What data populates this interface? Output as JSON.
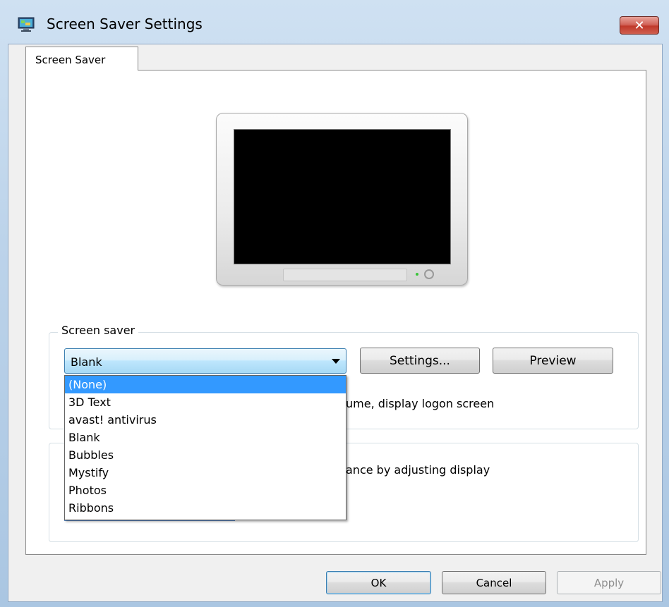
{
  "window": {
    "title": "Screen Saver Settings",
    "close_glyph": "✕",
    "icon": "display-settings-icon"
  },
  "tabs": [
    {
      "label": "Screen Saver",
      "active": true
    }
  ],
  "screensaver_group": {
    "legend": "Screen saver",
    "combo_selected": "Blank",
    "settings_label": "Settings...",
    "preview_label": "Preview",
    "resume_text_visible": "ume, display logon screen",
    "dropdown_options": [
      {
        "label": "(None)",
        "highlighted": true
      },
      {
        "label": "3D Text",
        "highlighted": false
      },
      {
        "label": "avast! antivirus",
        "highlighted": false
      },
      {
        "label": "Blank",
        "highlighted": false
      },
      {
        "label": "Bubbles",
        "highlighted": false
      },
      {
        "label": "Mystify",
        "highlighted": false
      },
      {
        "label": "Photos",
        "highlighted": false
      },
      {
        "label": "Ribbons",
        "highlighted": false
      }
    ]
  },
  "power_group": {
    "description_visible": "ance by adjusting display"
  },
  "footer": {
    "ok_label": "OK",
    "cancel_label": "Cancel",
    "apply_label": "Apply",
    "apply_enabled": false
  },
  "colors": {
    "selection": "#3399ff",
    "close_button": "#c0392b",
    "combo_border": "#3c7fb1"
  }
}
